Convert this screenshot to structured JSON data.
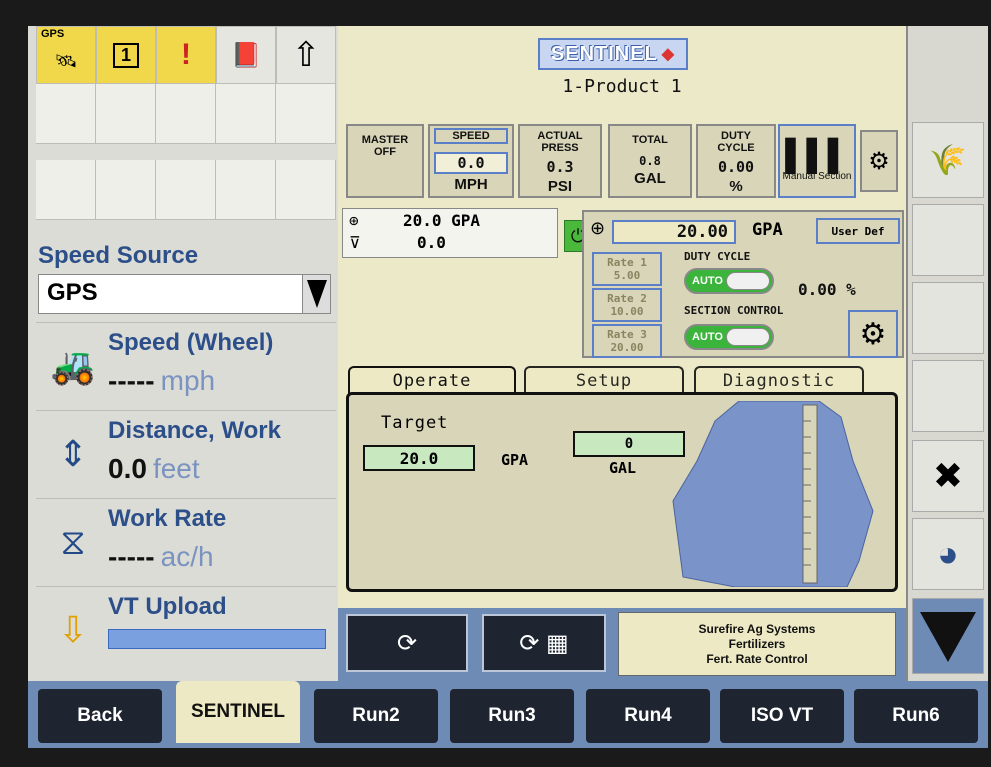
{
  "left": {
    "gps_label": "GPS",
    "speed_source": {
      "label": "Speed Source",
      "value": "GPS"
    },
    "metrics": [
      {
        "name": "Speed (Wheel)",
        "value": "-----",
        "unit": "mph"
      },
      {
        "name": "Distance, Work",
        "value": "0.0",
        "unit": "feet"
      },
      {
        "name": "Work Rate",
        "value": "-----",
        "unit": "ac/h"
      },
      {
        "name": "VT Upload"
      }
    ]
  },
  "center": {
    "logo": "SENTINEL",
    "product": "1-Product 1",
    "buttons": {
      "master": {
        "title": "MASTER OFF"
      },
      "speed": {
        "title": "SPEED",
        "value": "0.0",
        "unit": "MPH"
      },
      "press": {
        "title": "ACTUAL PRESS",
        "value": "0.3",
        "unit": "PSI"
      },
      "total": {
        "title": "TOTAL",
        "value": "0.8",
        "unit": "GAL"
      },
      "duty": {
        "title": "DUTY CYCLE",
        "value": "0.00",
        "unit": "%"
      },
      "manual": {
        "label": "Manual Section"
      }
    },
    "gpa_box": {
      "rate": "20.0  GPA",
      "flow": "0.0"
    },
    "rate_ctl": {
      "target": "20.00",
      "unit": "GPA",
      "user_def": "User Def",
      "rate1": "Rate 1\n5.00",
      "rate2": "Rate 2\n10.00",
      "rate3": "Rate 3\n20.00",
      "duty_label": "DUTY CYCLE",
      "duty_value": "0.00  %",
      "section_label": "SECTION CONTROL",
      "auto": "AUTO"
    },
    "tabs": [
      "Operate",
      "Setup",
      "Diagnostic"
    ],
    "operate": {
      "target_label": "Target",
      "target_value": "20.0",
      "target_unit": "GPA",
      "gal_value": "0",
      "gal_unit": "GAL"
    },
    "info": {
      "line1": "Surefire Ag Systems",
      "line2": "Fertilizers",
      "line3": "Fert. Rate Control"
    }
  },
  "bottom_tabs": [
    "Back",
    "SENTINEL",
    "Run2",
    "Run3",
    "Run4",
    "ISO VT",
    "Run6"
  ]
}
